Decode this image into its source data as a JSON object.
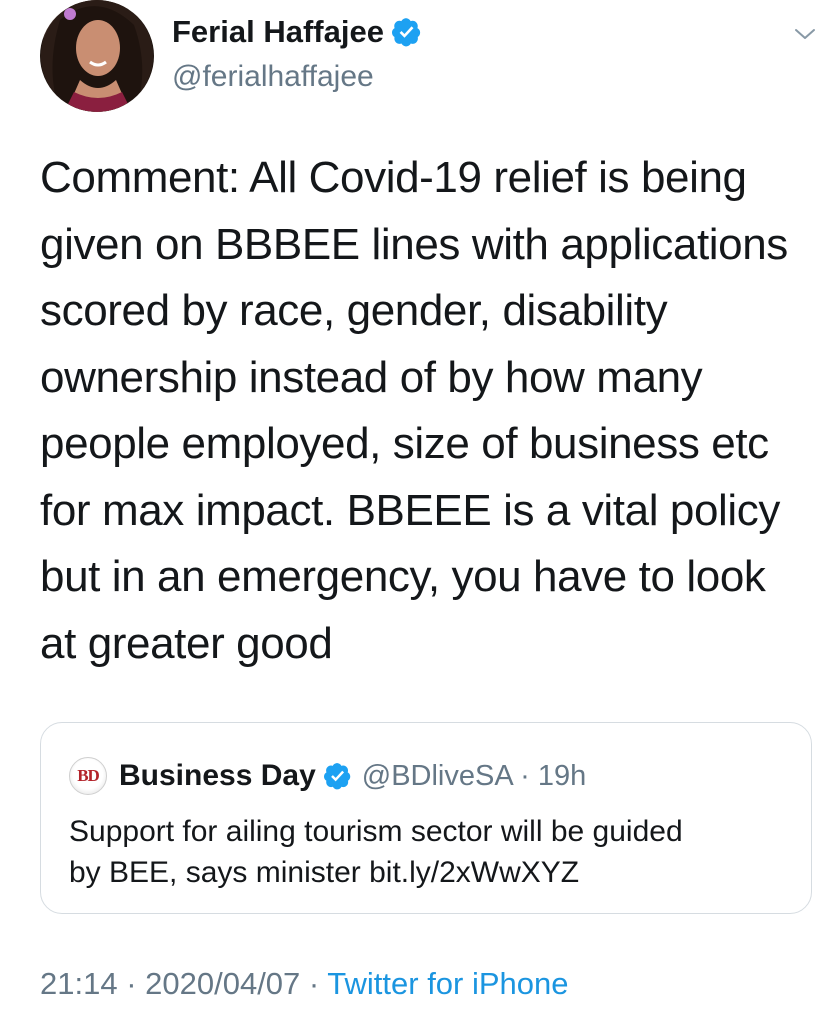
{
  "author": {
    "name": "Ferial Haffajee",
    "handle": "@ferialhaffajee"
  },
  "tweet": {
    "lines": [
      "Comment: All Covid-19 relief is being",
      "given on BBBEE lines with applications",
      "scored by race, gender, disability",
      "ownership instead of by how many",
      "people employed, size of business etc",
      "for max impact. BBEEE is a vital policy",
      "but in an emergency, you have to look",
      "at greater good"
    ]
  },
  "quoted": {
    "logo_text": "BD",
    "name": "Business Day",
    "handle_time": "@BDliveSA · 19h",
    "lines": [
      "Support for ailing tourism sector will be guided",
      "by BEE, says minister bit.ly/2xWwXYZ"
    ]
  },
  "meta": {
    "time": "21:14",
    "sep1": " · ",
    "date": "2020/04/07",
    "sep2": " · ",
    "source": "Twitter for iPhone"
  },
  "colors": {
    "verified": "#1da1f2",
    "secondary_text": "#657786",
    "link": "#1b95e0",
    "card_border": "#d6dce1"
  },
  "icons": [
    "verified-badge-icon",
    "chevron-down-icon"
  ]
}
